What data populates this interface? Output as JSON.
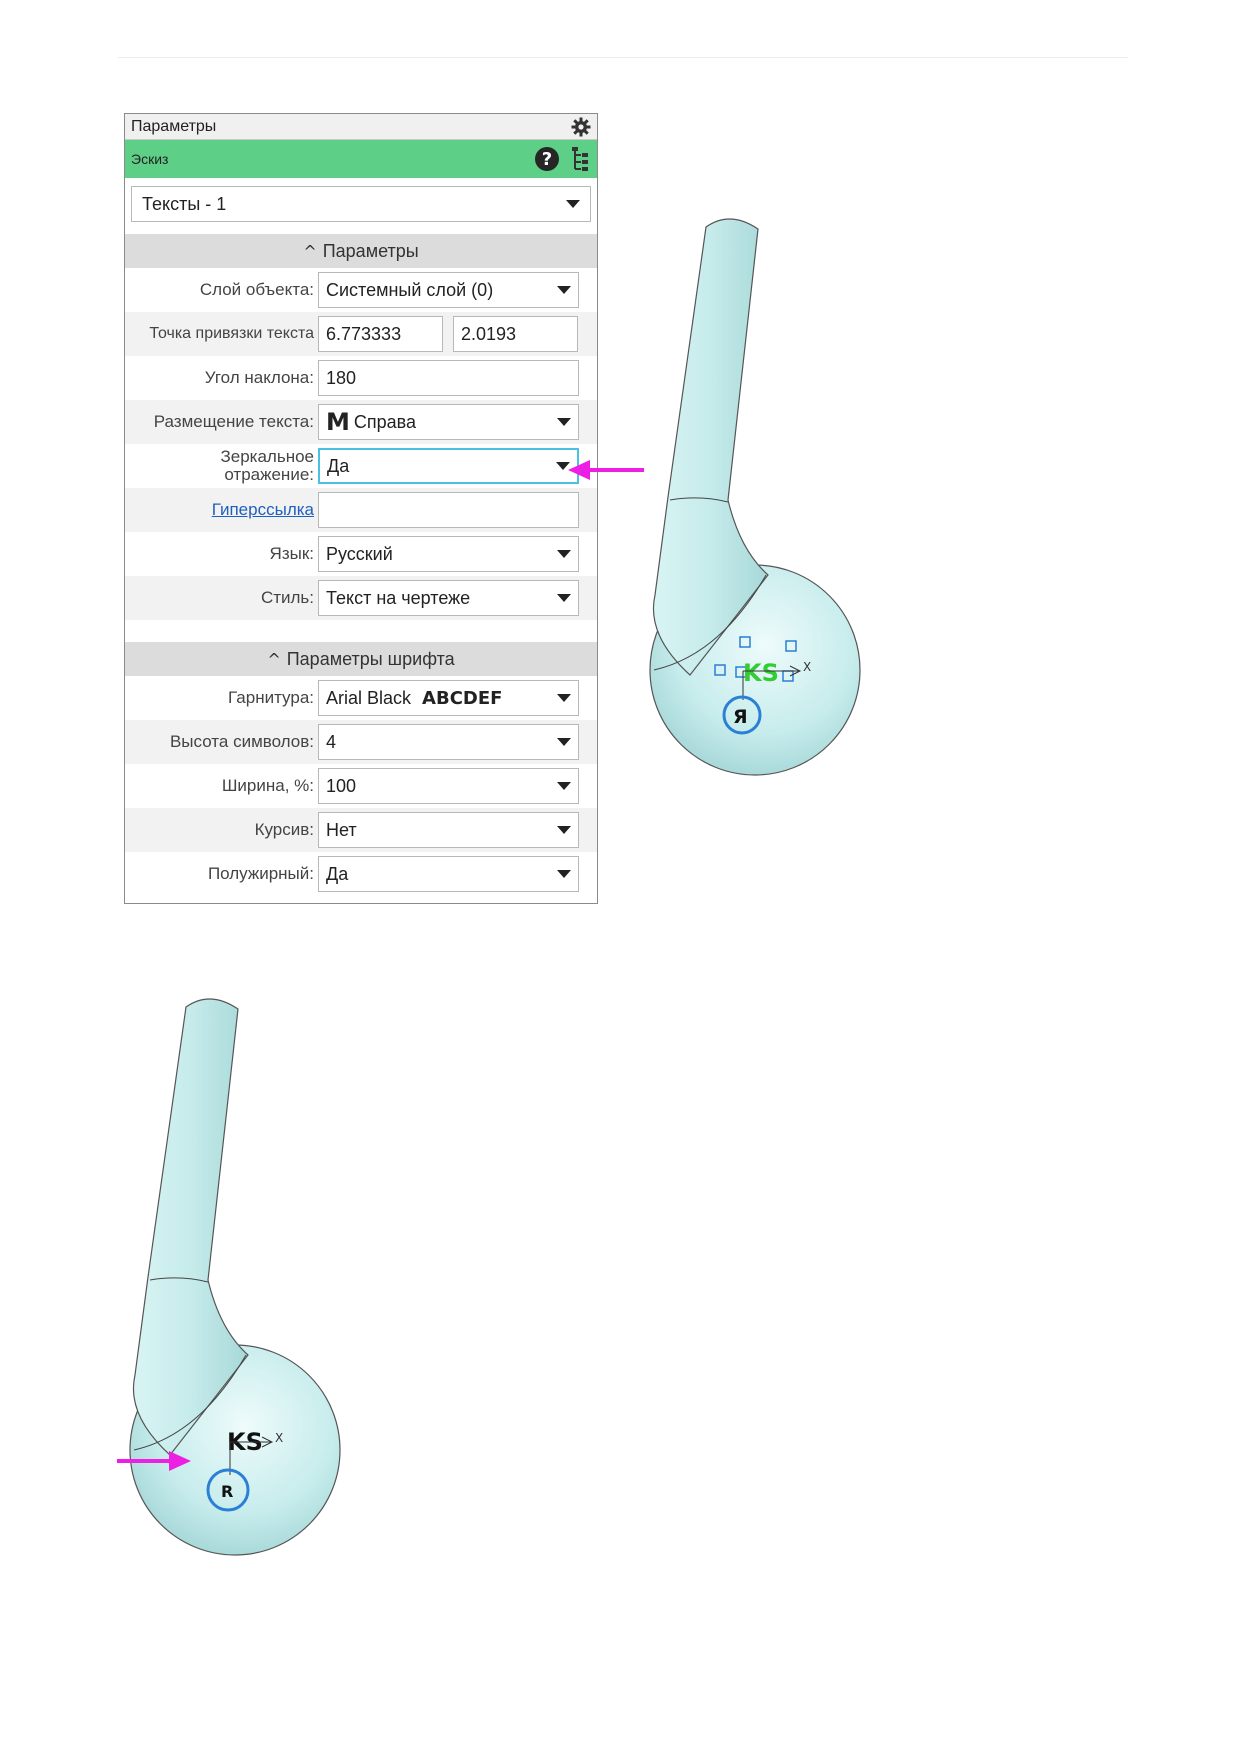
{
  "panel": {
    "title": "Параметры",
    "gear_icon": "gear-icon",
    "subtitle": "Эскиз",
    "help_icon": "help-icon",
    "tree_icon": "tree-icon",
    "object_select": "Тексты - 1"
  },
  "sections": {
    "parameters": "Параметры",
    "font_parameters": "Параметры шрифта"
  },
  "fields": {
    "layer": {
      "label": "Слой объекта:",
      "value": "Системный слой (0)"
    },
    "anchor": {
      "label": "Точка привязки текста",
      "x": "6.773333",
      "y": "2.0193"
    },
    "angle": {
      "label": "Угол наклона:",
      "value": "180"
    },
    "placement": {
      "label": "Размещение текста:",
      "icon": "M",
      "value": "Справа"
    },
    "mirror": {
      "label_line1": "Зеркальное",
      "label_line2": "отражение:",
      "value": "Да"
    },
    "hyperlink": {
      "label": "Гиперссылка",
      "value": ""
    },
    "language": {
      "label": "Язык:",
      "value": "Русский"
    },
    "style": {
      "label": "Стиль:",
      "value": "Текст на чертеже"
    },
    "typeface": {
      "label": "Гарнитура:",
      "value": "Arial Black",
      "sample": "ABCDEF"
    },
    "height": {
      "label": "Высота символов:",
      "value": "4"
    },
    "width": {
      "label": "Ширина, %:",
      "value": "100"
    },
    "italic": {
      "label": "Курсив:",
      "value": "Нет"
    },
    "bold": {
      "label": "Полужирный:",
      "value": "Да"
    }
  },
  "model_top": {
    "text": "KS",
    "axis_x": "X",
    "origin_glyph": "Я"
  },
  "model_bottom": {
    "text": "KS",
    "axis_x": "X",
    "origin_glyph": "R"
  },
  "colors": {
    "accent_green": "#5ecf87",
    "annotation_arrow": "#ee1fe4",
    "model_fill": "#c7ecec",
    "selected_text": "#33cc33",
    "focus_border": "#4cc0e0"
  }
}
